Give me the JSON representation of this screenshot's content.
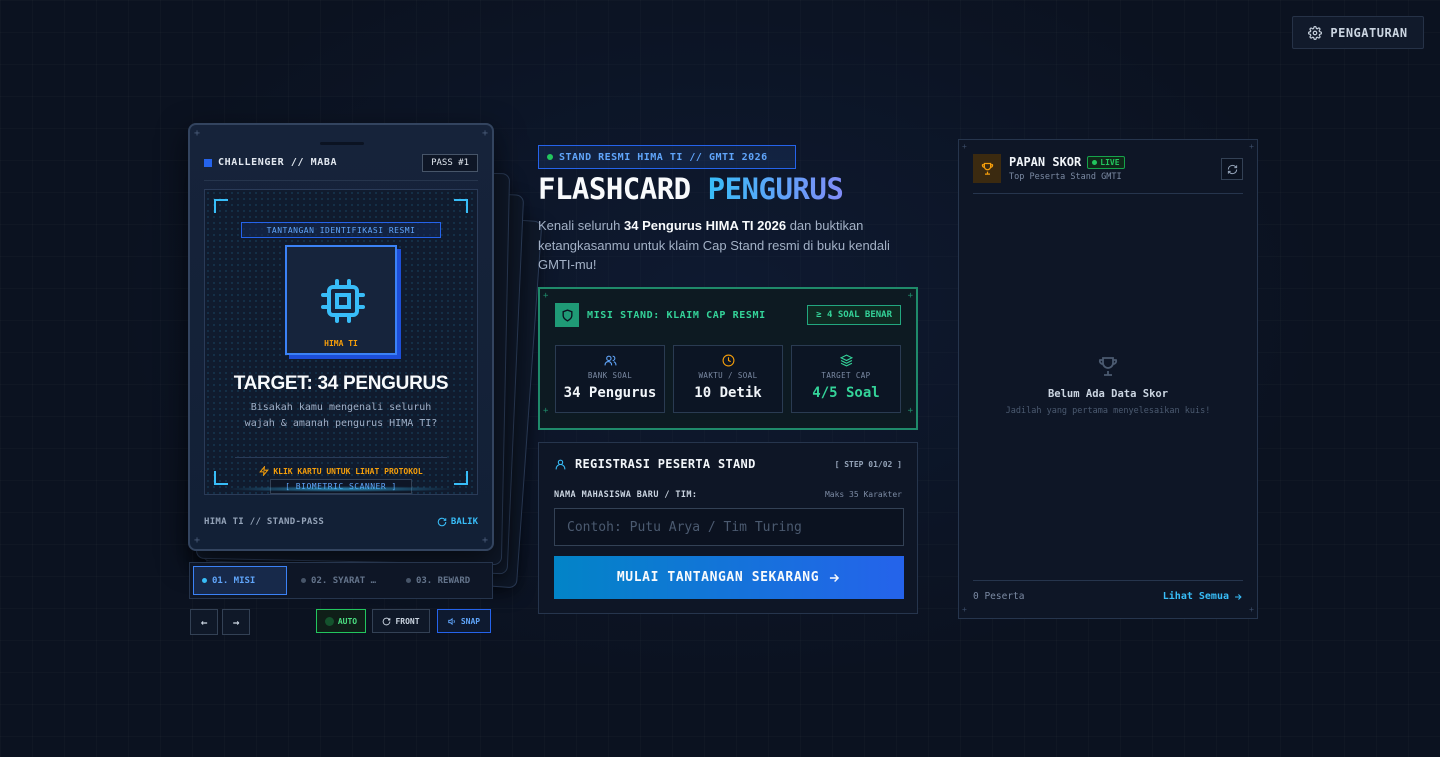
{
  "settings": {
    "label": "PENGATURAN"
  },
  "card": {
    "owner": "CHALLENGER // MABA",
    "pass": "PASS #1",
    "scan_title": "TANTANGAN IDENTIFIKASI RESMI",
    "chip_label": "HIMA TI",
    "target": "TARGET: 34 PENGURUS",
    "description": "Bisakah kamu mengenali seluruh wajah & amanah pengurus HIMA TI?",
    "hint": "KLIK KARTU UNTUK LIHAT PROTOKOL",
    "scanner": "[ BIOMETRIC SCANNER ]",
    "footer_left": "HIMA TI // STAND-PASS",
    "footer_right": "BALIK"
  },
  "card_tabs": [
    {
      "label": "01. MISI",
      "active": true
    },
    {
      "label": "02. SYARAT …",
      "active": false
    },
    {
      "label": "03. REWARD",
      "active": false
    }
  ],
  "controls": {
    "prev": "←",
    "next": "→",
    "auto": "AUTO",
    "front": "FRONT",
    "snap": "SNAP"
  },
  "hero": {
    "badge": "STAND RESMI HIMA TI // GMTI 2026",
    "title_white": "FLASHCARD",
    "title_accent": "PENGURUS",
    "desc_pre": "Kenali seluruh ",
    "desc_bold": "34 Pengurus HIMA TI 2026",
    "desc_post": " dan buktikan ketangkasanmu untuk klaim Cap Stand resmi di buku kendali GMTI-mu!"
  },
  "mission": {
    "title": "MISI STAND: KLAIM CAP RESMI",
    "badge": "≥ 4 SOAL BENAR",
    "stats": [
      {
        "icon": "users-icon",
        "label": "BANK SOAL",
        "value": "34 Pengurus"
      },
      {
        "icon": "clock-icon",
        "label": "WAKTU / SOAL",
        "value": "10 Detik"
      },
      {
        "icon": "layers-icon",
        "label": "TARGET CAP",
        "value": "4/5 Soal"
      }
    ]
  },
  "registration": {
    "title": "REGISTRASI PESERTA STAND",
    "step": "[ STEP 01/02 ]",
    "field_label": "NAMA MAHASISWA BARU / TIM:",
    "field_hint": "Maks 35 Karakter",
    "placeholder": "Contoh: Putu Arya / Tim Turing",
    "value": "",
    "button": "MULAI TANTANGAN SEKARANG"
  },
  "leaderboard": {
    "title": "PAPAN SKOR",
    "live": "LIVE",
    "subtitle": "Top Peserta Stand GMTI",
    "empty_title": "Belum Ada Data Skor",
    "empty_sub": "Jadilah yang pertama menyelesaikan kuis!",
    "count": "0 Peserta",
    "see_all": "Lihat Semua"
  },
  "colors": {
    "accent_blue": "#38bdf8",
    "accent_green": "#34d399",
    "accent_amber": "#f59e0b",
    "background": "#0b1220"
  }
}
